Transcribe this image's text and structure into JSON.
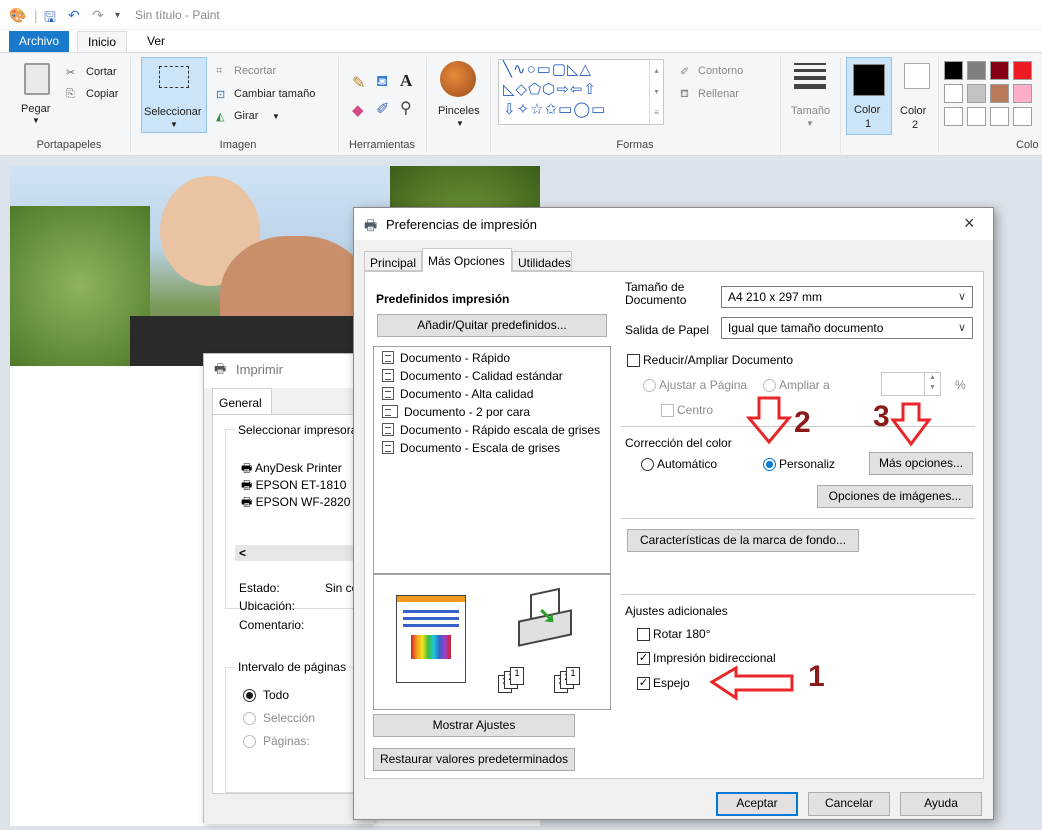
{
  "window": {
    "title": "Sin título - Paint"
  },
  "ribbon_tabs": {
    "file": "Archivo",
    "home": "Inicio",
    "view": "Ver"
  },
  "ribbon": {
    "paste": "Pegar",
    "cut": "Cortar",
    "copy": "Copiar",
    "clipboard_group": "Portapapeles",
    "select": "Seleccionar",
    "crop": "Recortar",
    "resize": "Cambiar tamaño",
    "rotate": "Girar",
    "image_group": "Imagen",
    "tools_group": "Herramientas",
    "brushes": "Pinceles",
    "outline": "Contorno",
    "fill": "Rellenar",
    "shapes_group": "Formas",
    "size": "Tamaño",
    "color1_a": "Color",
    "color1_b": "1",
    "color2_a": "Color",
    "color2_b": "2",
    "colors_group": "Colo",
    "tool_text": "A"
  },
  "colors": {
    "row1": [
      "#000000",
      "#7f7f7f",
      "#880015",
      "#ed1c24"
    ],
    "row2": [
      "#ffffff",
      "#c3c3c3",
      "#b97a57",
      "#ffaec9"
    ],
    "row3": [
      "#ffffff",
      "#ffffff",
      "#ffffff",
      "#ffffff"
    ],
    "accent": "#1979ca"
  },
  "print_dialog": {
    "title": "Imprimir",
    "tab_general": "General",
    "select_printer": "Seleccionar impresora",
    "printers": [
      "AnyDesk Printer",
      "EPSON ET-1810",
      "EPSON WF-2820"
    ],
    "status_label": "Estado:",
    "status_value": "Sin co",
    "location_label": "Ubicación:",
    "comment_label": "Comentario:",
    "page_range": "Intervalo de páginas",
    "range_all": "Todo",
    "range_selection": "Selección",
    "range_pages": "Páginas:",
    "scroll_left": "<"
  },
  "pref_dialog": {
    "title": "Preferencias de impresión",
    "close": "×",
    "tabs": [
      "Principal",
      "Más Opciones",
      "Utilidades"
    ],
    "presets_title": "Predefinidos impresión",
    "add_remove_presets": "Añadir/Quitar predefinidos...",
    "presets": [
      "Documento - Rápido",
      "Documento - Calidad estándar",
      "Documento - Alta calidad",
      "Documento - 2 por cara",
      "Documento - Rápido escala de grises",
      "Documento - Escala de grises"
    ],
    "show_settings": "Mostrar Ajustes",
    "restore_defaults": "Restaurar valores predeterminados",
    "doc_size_label_1": "Tamaño de",
    "doc_size_label_2": "Documento",
    "doc_size_value": "A4 210 x 297 mm",
    "paper_output_label": "Salida de Papel",
    "paper_output_value": "Igual que tamaño documento",
    "reduce_enlarge": "Reducir/Ampliar Documento",
    "fit_page": "Ajustar a Página",
    "enlarge_to": "Ampliar a",
    "percent": "%",
    "center": "Centro",
    "color_correction": "Corrección del color",
    "automatic": "Automático",
    "custom": "Personaliz",
    "more_options": "Más opciones...",
    "image_options": "Opciones de imágenes...",
    "watermark": "Características de la marca de fondo...",
    "additional_settings": "Ajustes adicionales",
    "rotate_180": "Rotar 180°",
    "bidirectional": "Impresión bidireccional",
    "mirror": "Espejo",
    "ok": "Aceptar",
    "cancel": "Cancelar",
    "help": "Ayuda",
    "doc_order_label_a": "1",
    "doc_order_label_b": "2",
    "doc_order_label_c": "3"
  },
  "annotations": {
    "one": "1",
    "two": "2",
    "three": "3",
    "arrow_color": "#e8262a"
  }
}
